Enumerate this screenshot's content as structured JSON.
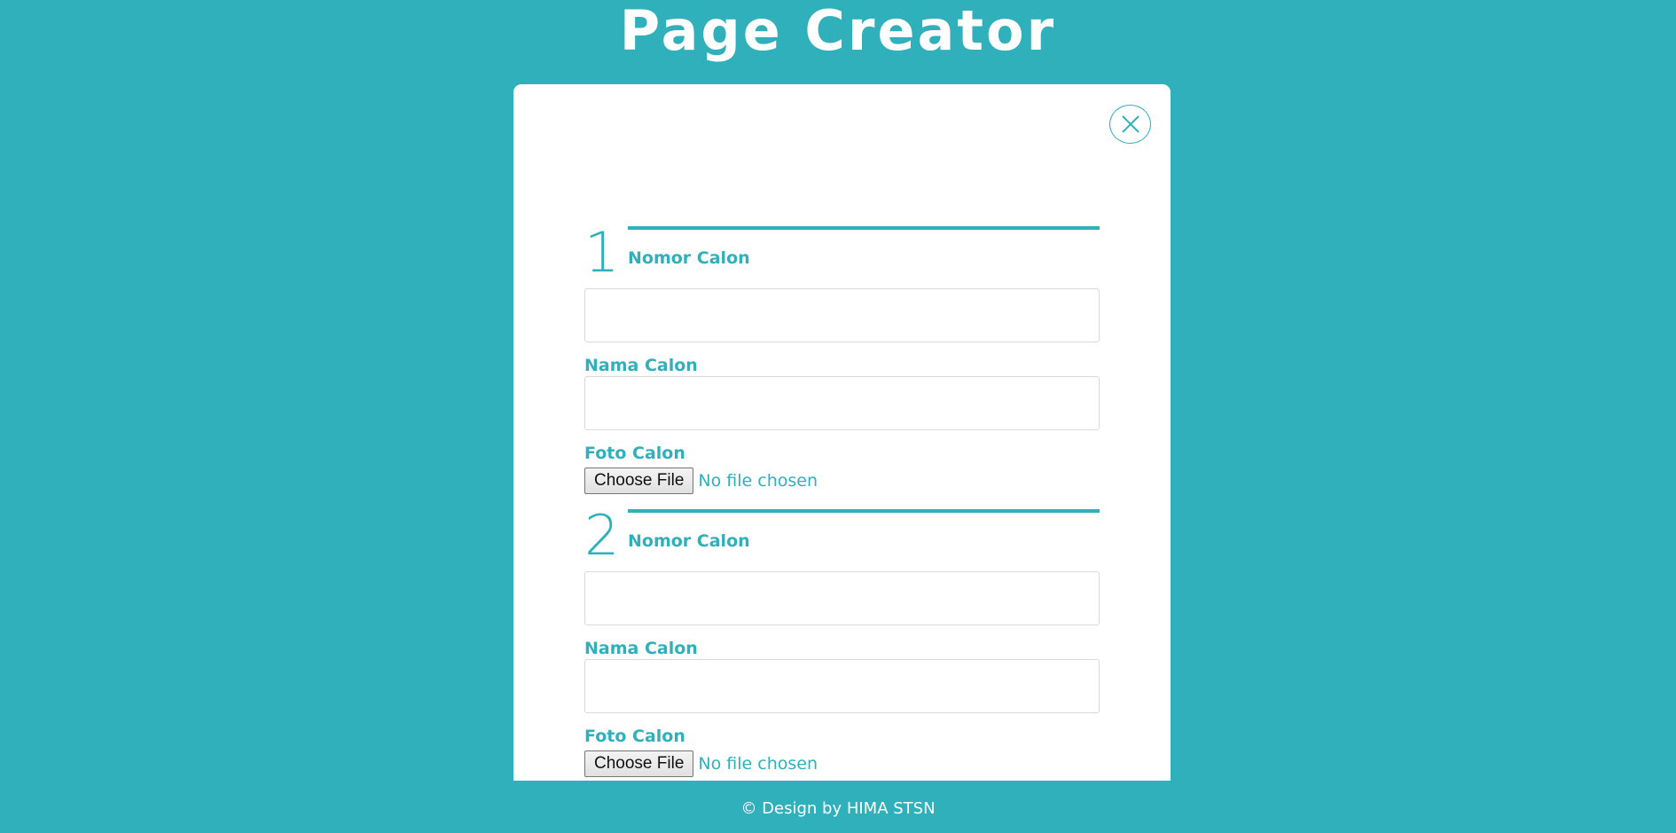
{
  "header": {
    "title": "Page Creator"
  },
  "modal": {
    "close_label": "X",
    "sections": [
      {
        "number": "1",
        "nomor_label": "Nomor Calon",
        "nama_label": "Nama Calon",
        "foto_label": "Foto Calon",
        "nomor_value": "",
        "nama_value": "",
        "choose_file_label": "Choose File",
        "file_status": "No file chosen"
      },
      {
        "number": "2",
        "nomor_label": "Nomor Calon",
        "nama_label": "Nama Calon",
        "foto_label": "Foto Calon",
        "nomor_value": "",
        "nama_value": "",
        "choose_file_label": "Choose File",
        "file_status": "No file chosen"
      }
    ]
  },
  "footer": {
    "text": "© Design by HIMA STSN"
  },
  "colors": {
    "background": "#30b0bb",
    "card": "#ffffff",
    "accent": "#30b0bb"
  },
  "icons": {
    "close": "close-x-circle-icon"
  }
}
